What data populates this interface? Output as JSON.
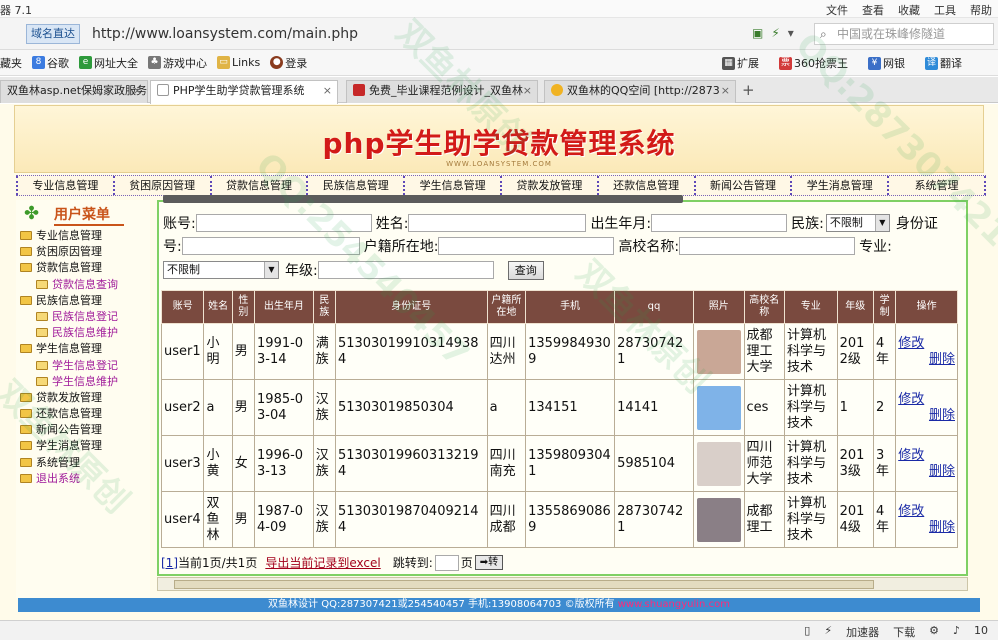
{
  "browser": {
    "app_title": "器 7.1",
    "menus": [
      "文件",
      "查看",
      "收藏",
      "工具",
      "帮助"
    ],
    "mode_label": "域名直达",
    "url": "http://www.loansystem.com/main.php",
    "search_placeholder": "中国或在珠峰修隧道",
    "bookmarks": [
      "藏夹",
      "谷歌",
      "网址大全",
      "游戏中心",
      "Links",
      "登录"
    ],
    "bookmarks_right": [
      "扩展",
      "360抢票王",
      "网银",
      "翻译"
    ],
    "tabs": [
      {
        "title": "双鱼林asp.net保姆家政服务"
      },
      {
        "title": "PHP学生助学贷款管理系统"
      },
      {
        "title": "免费_毕业课程范例设计_双鱼林"
      },
      {
        "title": "双鱼林的QQ空间 [http://2873"
      }
    ],
    "status": {
      "accelerator": "加速器",
      "download": "下载",
      "zoom": "10"
    }
  },
  "banner": {
    "title": "php学生助学贷款管理系统",
    "sub": "WWW.LOANSYSTEM.COM"
  },
  "topnav": [
    "专业信息管理",
    "贫困原因管理",
    "贷款信息管理",
    "民族信息管理",
    "学生信息管理",
    "贷款发放管理",
    "还款信息管理",
    "新闻公告管理",
    "学生消息管理",
    "系统管理"
  ],
  "sidebar": {
    "title": "用户菜单",
    "items": [
      {
        "label": "专业信息管理",
        "sub": false
      },
      {
        "label": "贫困原因管理",
        "sub": false
      },
      {
        "label": "贷款信息管理",
        "sub": false
      },
      {
        "label": "贷款信息查询",
        "sub": true
      },
      {
        "label": "民族信息管理",
        "sub": false
      },
      {
        "label": "民族信息登记",
        "sub": true
      },
      {
        "label": "民族信息维护",
        "sub": true
      },
      {
        "label": "学生信息管理",
        "sub": false
      },
      {
        "label": "学生信息登记",
        "sub": true
      },
      {
        "label": "学生信息维护",
        "sub": true
      },
      {
        "label": "贷款发放管理",
        "sub": false
      },
      {
        "label": "还款信息管理",
        "sub": false
      },
      {
        "label": "新闻公告管理",
        "sub": false
      },
      {
        "label": "学生消息管理",
        "sub": false
      },
      {
        "label": "系统管理",
        "sub": false
      },
      {
        "label": "退出系统",
        "sub": false
      }
    ]
  },
  "search_form": {
    "account": "账号:",
    "name": "姓名:",
    "birth": "出生年月:",
    "nation": "民族:",
    "nation_value": "不限制",
    "idcard_1": "身份证",
    "idcard_2": "号:",
    "hukou": "户籍所在地:",
    "school": "高校名称:",
    "major": "专业:",
    "major_value": "不限制",
    "grade": "年级:",
    "search_button": "查询"
  },
  "table": {
    "headers": [
      "账号",
      "姓名",
      "性别",
      "出生年月",
      "民族",
      "身份证号",
      "户籍所在地",
      "手机",
      "qq",
      "照片",
      "高校名称",
      "专业",
      "年级",
      "学制",
      "操作"
    ],
    "rows": [
      {
        "account": "user1",
        "name": "小明",
        "gender": "男",
        "birth": "1991-03-14",
        "nation": "满族",
        "idcard": "513030199103149384",
        "hukou": "四川达州",
        "phone": "13599849309",
        "qq": "287307421",
        "school": "成都理工大学",
        "major": "计算机科学与技术",
        "grade": "2012级",
        "years": "4年",
        "photo_color": "#c9a796"
      },
      {
        "account": "user2",
        "name": "a",
        "gender": "男",
        "birth": "1985-03-04",
        "nation": "汉族",
        "idcard": "51303019850304",
        "hukou": "a",
        "phone": "134151",
        "qq": "14141",
        "school": "ces",
        "major": "计算机科学与技术",
        "grade": "1",
        "years": "2",
        "photo_color": "#7fb3e8"
      },
      {
        "account": "user3",
        "name": "小黄",
        "gender": "女",
        "birth": "1996-03-13",
        "nation": "汉族",
        "idcard": "513030199603132194",
        "hukou": "四川南充",
        "phone": "13598093041",
        "qq": "5985104",
        "school": "四川师范大学",
        "major": "计算机科学与技术",
        "grade": "2013级",
        "years": "3年",
        "photo_color": "#d9cfc9"
      },
      {
        "account": "user4",
        "name": "双鱼林",
        "gender": "男",
        "birth": "1987-04-09",
        "nation": "汉族",
        "idcard": "513030198704092144",
        "hukou": "四川成都",
        "phone": "13558690869",
        "qq": "287307421",
        "school": "成都理工",
        "major": "计算机科学与技术",
        "grade": "2014级",
        "years": "4年",
        "photo_color": "#8a7f86"
      }
    ],
    "edit_label": "修改",
    "delete_label": "删除"
  },
  "pager": {
    "page_link": "[1]",
    "info": "当前1页/共1页",
    "export": "导出当前记录到excel",
    "jump_label": "跳转到:",
    "page_unit": "页",
    "go_button": "➡转"
  },
  "footer": {
    "text": "双鱼林设计 QQ:287307421或254540457 手机:13908064703 ©版权所有 ",
    "link": "www.shuangyulin.com"
  },
  "colors": {
    "header_bg": "#7a4a3f",
    "footer_bg": "#3d8bd0",
    "banner_title": "#d21a18",
    "accent_green": "#7fd064"
  }
}
